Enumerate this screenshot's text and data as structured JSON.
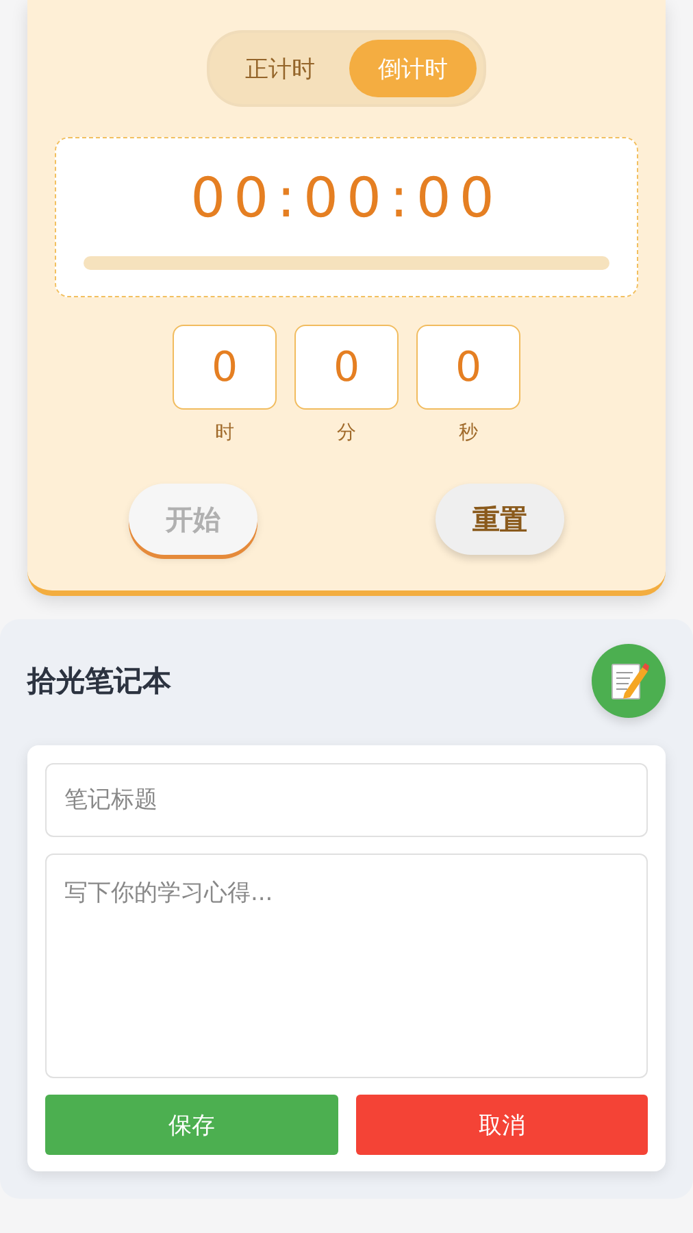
{
  "timer": {
    "modes": [
      {
        "label": "正计时",
        "selected": false
      },
      {
        "label": "倒计时",
        "selected": true
      }
    ],
    "display": "00:00:00",
    "progress": {
      "level": 0
    },
    "units": [
      {
        "value": "0",
        "label": "时"
      },
      {
        "value": "0",
        "label": "分"
      },
      {
        "value": "0",
        "label": "秒"
      }
    ],
    "buttons": [
      {
        "label": "开始",
        "kind": "start",
        "disabled": true
      },
      {
        "label": "重置",
        "kind": "reset",
        "disabled": false
      }
    ]
  },
  "notebook": {
    "title": "拾光笔记本",
    "title_field": {
      "placeholder": "笔记标题"
    },
    "body_field": {
      "placeholder": "写下你的学习心得..."
    },
    "buttons": [
      {
        "label": "保存",
        "kind": "save"
      },
      {
        "label": "取消",
        "kind": "cancel"
      }
    ]
  }
}
